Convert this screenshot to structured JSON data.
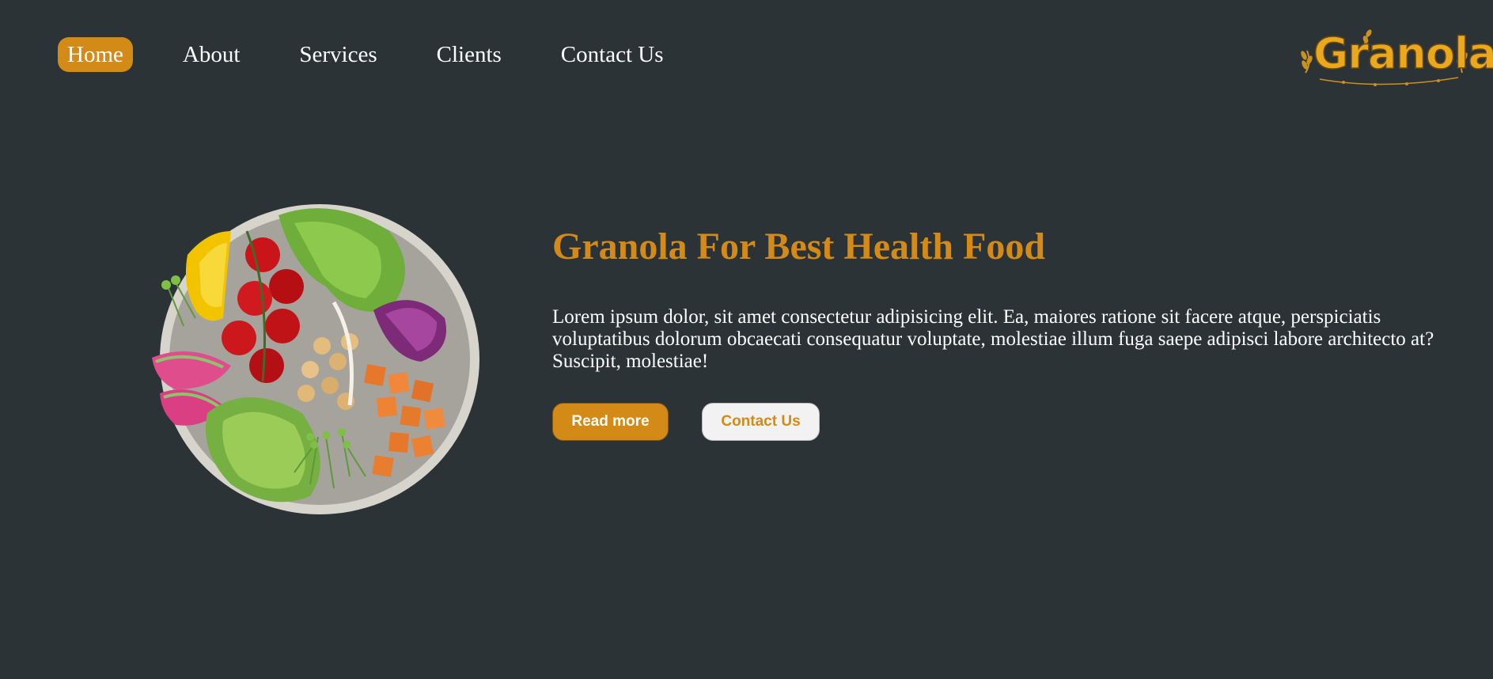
{
  "nav": {
    "items": [
      {
        "label": "Home",
        "active": true
      },
      {
        "label": "About",
        "active": false
      },
      {
        "label": "Services",
        "active": false
      },
      {
        "label": "Clients",
        "active": false
      },
      {
        "label": "Contact Us",
        "active": false
      }
    ]
  },
  "logo": {
    "text": "Granola"
  },
  "hero": {
    "title": "Granola For Best Health Food",
    "description": "Lorem ipsum dolor, sit amet consectetur adipisicing elit. Ea, maiores ratione sit facere atque, perspiciatis voluptatibus dolorum obcaecati consequatur voluptate, molestiae illum fuga saepe adipisci labore architecto at? Suscipit, molestiae!",
    "primary_button": "Read more",
    "secondary_button": "Contact Us"
  },
  "colors": {
    "background": "#2c3336",
    "accent": "#d48a17",
    "text": "#ffffff"
  }
}
